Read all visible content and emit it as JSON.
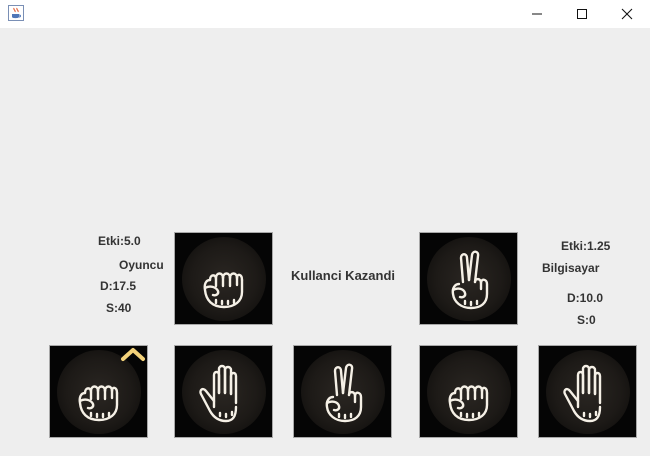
{
  "window": {
    "title_icon": "java-coffee-icon",
    "minimize_icon": "minimize-icon",
    "maximize_icon": "maximize-icon",
    "close_icon": "close-icon"
  },
  "player": {
    "etki": "Etki:5.0",
    "name": "Oyuncu",
    "d": "D:17.5",
    "s": "S:40"
  },
  "computer": {
    "etki": "Etki:1.25",
    "name": "Bilgisayar",
    "d": "D:10.0",
    "s": "S:0"
  },
  "result_text": "Kullanci Kazandi",
  "played": {
    "player_hand": "rock",
    "computer_hand": "scissors"
  },
  "hand_choices": [
    "rock",
    "paper",
    "scissors",
    "rock",
    "paper"
  ],
  "selected_indicator_icon": "chevron-up-icon",
  "colors": {
    "card_bg": "#050505",
    "hand_outline": "#f5f0e6",
    "chevron": "#f3d27a",
    "background": "#eeeeee"
  }
}
